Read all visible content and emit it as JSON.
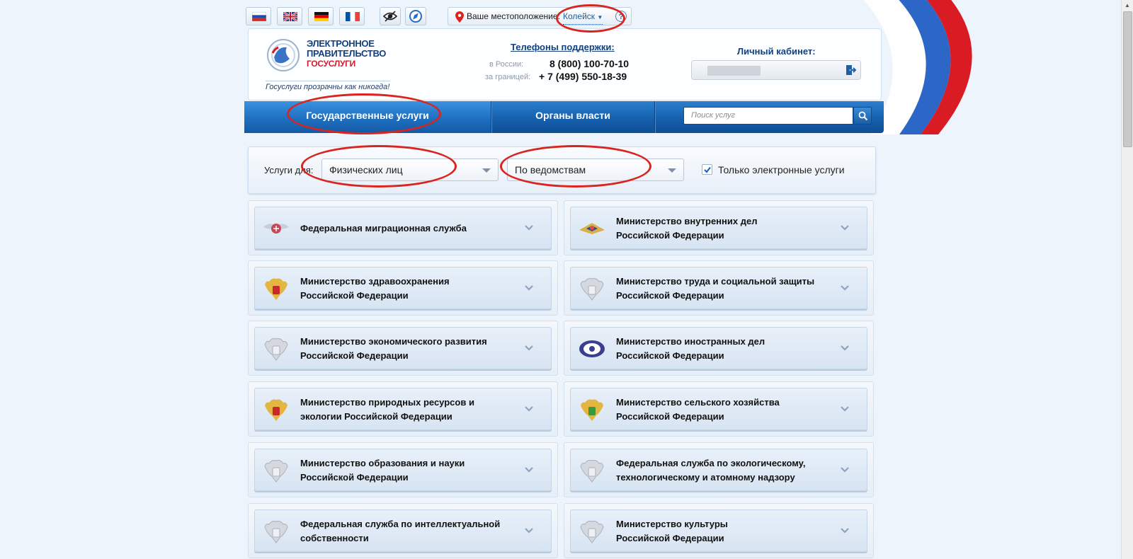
{
  "languages": [
    {
      "code": "ru",
      "name": "russian-flag"
    },
    {
      "code": "en",
      "name": "uk-flag"
    },
    {
      "code": "de",
      "name": "german-flag"
    },
    {
      "code": "fr",
      "name": "french-flag"
    }
  ],
  "tools": [
    "accessibility-eye-icon",
    "compass-icon"
  ],
  "location": {
    "label": "Ваше местоположение:",
    "city": "Колейск",
    "help": "?"
  },
  "logo": {
    "line1": "ЭЛЕКТРОННОЕ",
    "line2": "ПРАВИТЕЛЬСТВО",
    "line3": "ГОСУСЛУГИ",
    "slogan": "Госуслуги прозрачны как никогда!"
  },
  "support": {
    "title": "Телефоны поддержки",
    "colon": ":",
    "russia_label": "в России:",
    "russia_phone": "8 (800) 100-70-10",
    "abroad_label": "за границей:",
    "abroad_phone": "+ 7 (499) 550-18-39"
  },
  "cabinet": {
    "title": "Личный кабинет:"
  },
  "nav": {
    "tab1": "Государственные услуги",
    "tab2": "Органы власти",
    "search_placeholder": "Поиск услуг"
  },
  "filters": {
    "label": "Услуги для:",
    "audience": "Физических лиц",
    "grouping": "По ведомствам",
    "electronic_only_label": "Только электронные услуги",
    "electronic_only_checked": true
  },
  "services": [
    {
      "line1": "Федеральная миграционная служба",
      "line2": "",
      "emblem": "fms"
    },
    {
      "line1": "Министерство внутренних дел",
      "line2": "Российской Федерации",
      "emblem": "mvd"
    },
    {
      "line1": "Министерство здравоохранения",
      "line2": "Российской Федерации",
      "emblem": "eagle-color"
    },
    {
      "line1": "Министерство труда и социальной защиты",
      "line2": "Российской Федерации",
      "emblem": "eagle-gray"
    },
    {
      "line1": "Министерство экономического развития",
      "line2": "Российской Федерации",
      "emblem": "eagle-gray"
    },
    {
      "line1": "Министерство иностранных дел",
      "line2": "Российской Федерации",
      "emblem": "mid"
    },
    {
      "line1": "Министерство природных ресурсов и",
      "line2": "экологии Российской Федерации",
      "emblem": "eagle-color"
    },
    {
      "line1": "Министерство сельского хозяйства",
      "line2": "Российской Федерации",
      "emblem": "eagle-green"
    },
    {
      "line1": "Министерство образования и науки",
      "line2": "Российской Федерации",
      "emblem": "eagle-gray"
    },
    {
      "line1": "Федеральная служба по экологическому,",
      "line2": "технологическому и атомному надзору",
      "emblem": "eagle-gray"
    },
    {
      "line1": "Федеральная служба по интеллектуальной",
      "line2": "собственности",
      "emblem": "eagle-gray"
    },
    {
      "line1": "Министерство культуры",
      "line2": "Российской Федерации",
      "emblem": "eagle-gray"
    }
  ],
  "colors": {
    "brand_blue": "#12407f",
    "nav_blue": "#1f6fc0",
    "logo_red": "#d61a2a",
    "annotation_red": "#d9241f"
  }
}
